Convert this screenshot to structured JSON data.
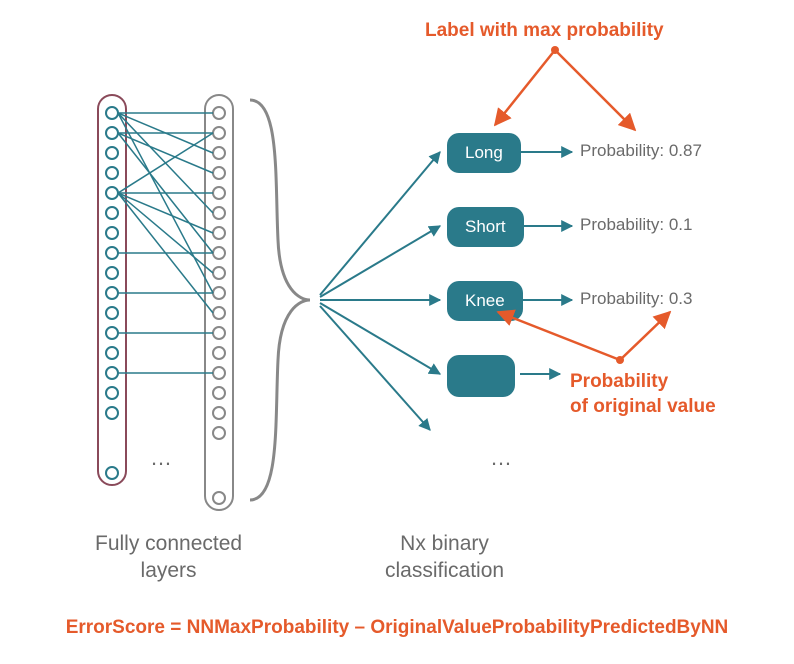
{
  "annotations": {
    "top": "Label with max probability",
    "bottom_line1": "Probability",
    "bottom_line2": "of original value"
  },
  "classes": [
    {
      "label": "Long",
      "prob_text": "Probability: 0.87"
    },
    {
      "label": "Short",
      "prob_text": "Probability: 0.1"
    },
    {
      "label": "Knee",
      "prob_text": "Probability: 0.3"
    },
    {
      "label": "",
      "prob_text": ""
    }
  ],
  "captions": {
    "left_line1": "Fully connected",
    "left_line2": "layers",
    "right_line1": "Nx binary",
    "right_line2": "classification"
  },
  "ellipsis": "…",
  "formula": "ErrorScore = NNMaxProbability – OriginalValueProbabilityPredictedByNN",
  "colors": {
    "teal": "#2a7a8a",
    "orange": "#e55a2b",
    "gray": "#888888",
    "maroon": "#8a4a5a"
  },
  "chart_data": {
    "type": "diagram",
    "title": "Neural network multi-output classification scoring",
    "layers": [
      "input-layer",
      "hidden-layer"
    ],
    "outputs": [
      {
        "label": "Long",
        "probability": 0.87,
        "is_max": true
      },
      {
        "label": "Short",
        "probability": 0.1
      },
      {
        "label": "Knee",
        "probability": 0.3,
        "is_original": true
      }
    ],
    "formula": "ErrorScore = NNMaxProbability - OriginalValueProbabilityPredictedByNN"
  }
}
